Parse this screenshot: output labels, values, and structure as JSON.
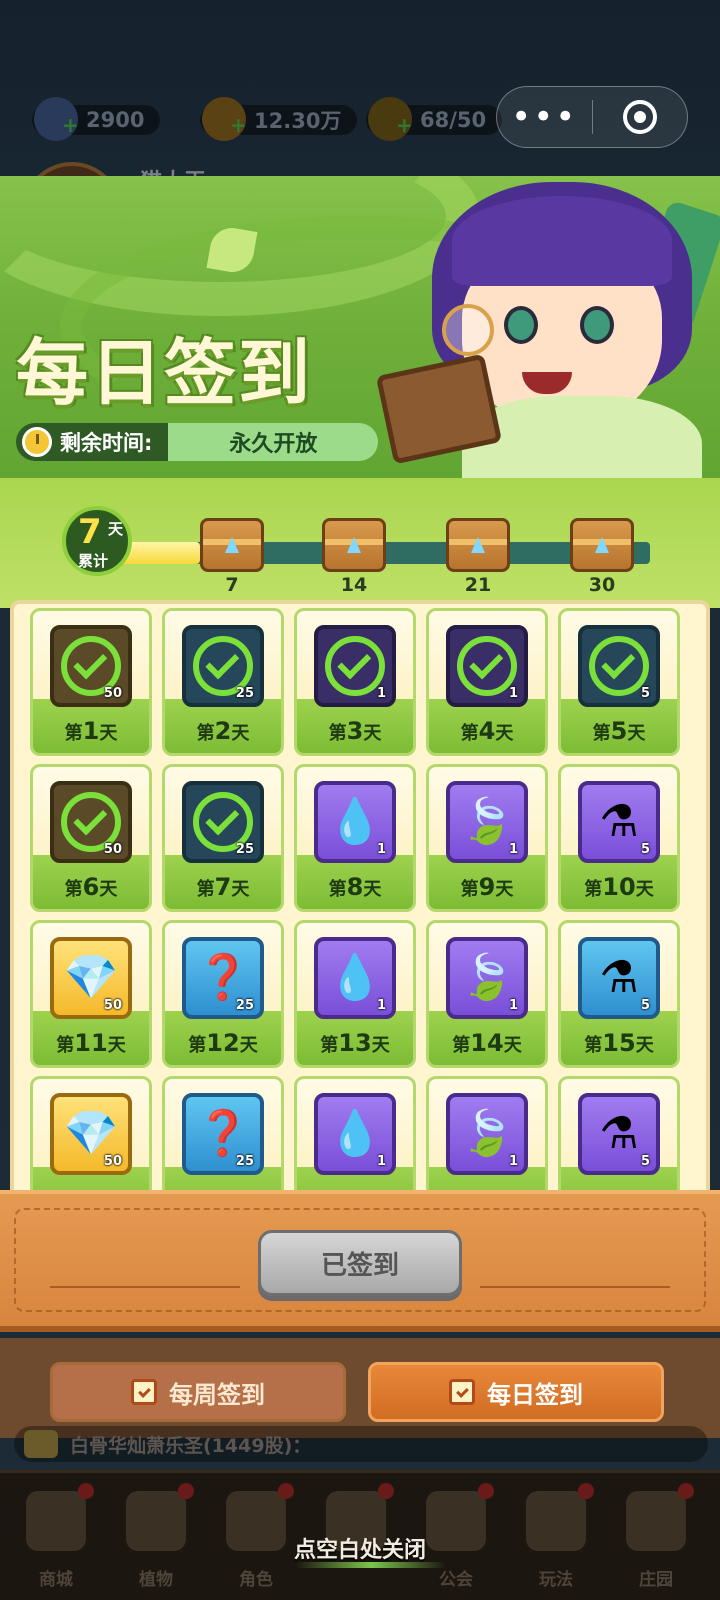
{
  "hud": {
    "diamonds": "2900",
    "coins": "12.30万",
    "energy": "68/50",
    "player_name": "猫大王"
  },
  "mini_program": {
    "more_icon": "more-dots-icon",
    "close_icon": "target-close-icon"
  },
  "modal": {
    "title": "每日签到",
    "time_label": "剩余时间:",
    "time_value": "永久开放"
  },
  "progress": {
    "days": "7",
    "days_unit": "天",
    "days_caption": "累计",
    "fill_fraction": 0.15,
    "milestones": [
      "7",
      "14",
      "21",
      "30"
    ]
  },
  "days": [
    {
      "prefix": "第",
      "num": "1",
      "suffix": "天",
      "state": "claimed",
      "icon_bg": "dim-brown",
      "qty": "50"
    },
    {
      "prefix": "第",
      "num": "2",
      "suffix": "天",
      "state": "claimed",
      "icon_bg": "dim-blue",
      "qty": "25"
    },
    {
      "prefix": "第",
      "num": "3",
      "suffix": "天",
      "state": "claimed",
      "icon_bg": "dim-purple",
      "qty": "1"
    },
    {
      "prefix": "第",
      "num": "4",
      "suffix": "天",
      "state": "claimed",
      "icon_bg": "dim-purple",
      "qty": "1"
    },
    {
      "prefix": "第",
      "num": "5",
      "suffix": "天",
      "state": "claimed",
      "icon_bg": "dim-blue",
      "qty": "5"
    },
    {
      "prefix": "第",
      "num": "6",
      "suffix": "天",
      "state": "claimed",
      "icon_bg": "dim-brown",
      "qty": "50"
    },
    {
      "prefix": "第",
      "num": "7",
      "suffix": "天",
      "state": "claimed",
      "icon_bg": "dim-blue",
      "qty": "25"
    },
    {
      "prefix": "第",
      "num": "8",
      "suffix": "天",
      "state": "locked",
      "icon_bg": "purple",
      "item": "drop-icon",
      "glyph": "💧",
      "qty": "1"
    },
    {
      "prefix": "第",
      "num": "9",
      "suffix": "天",
      "state": "locked",
      "icon_bg": "purple",
      "item": "leaf-icon",
      "glyph": "🍃",
      "qty": "1"
    },
    {
      "prefix": "第",
      "num": "10",
      "suffix": "天",
      "state": "locked",
      "icon_bg": "purple",
      "item": "potion-icon",
      "glyph": "⚗",
      "qty": "5"
    },
    {
      "prefix": "第",
      "num": "11",
      "suffix": "天",
      "state": "locked",
      "icon_bg": "gold",
      "item": "diamond-icon",
      "glyph": "💎",
      "qty": "50"
    },
    {
      "prefix": "第",
      "num": "12",
      "suffix": "天",
      "state": "locked",
      "icon_bg": "blue",
      "item": "mystery-seed-icon",
      "glyph": "❓",
      "qty": "25"
    },
    {
      "prefix": "第",
      "num": "13",
      "suffix": "天",
      "state": "locked",
      "icon_bg": "purple",
      "item": "drop-icon",
      "glyph": "💧",
      "qty": "1"
    },
    {
      "prefix": "第",
      "num": "14",
      "suffix": "天",
      "state": "locked",
      "icon_bg": "purple",
      "item": "leaf-icon",
      "glyph": "🍃",
      "qty": "1"
    },
    {
      "prefix": "第",
      "num": "15",
      "suffix": "天",
      "state": "locked",
      "icon_bg": "blue",
      "item": "potion-icon",
      "glyph": "⚗",
      "qty": "5"
    },
    {
      "prefix": "",
      "num": "",
      "suffix": "",
      "state": "locked",
      "icon_bg": "gold",
      "item": "diamond-icon",
      "glyph": "💎",
      "qty": "50"
    },
    {
      "prefix": "",
      "num": "",
      "suffix": "",
      "state": "locked",
      "icon_bg": "blue",
      "item": "mystery-seed-icon",
      "glyph": "❓",
      "qty": "25"
    },
    {
      "prefix": "",
      "num": "",
      "suffix": "",
      "state": "locked",
      "icon_bg": "purple",
      "item": "drop-icon",
      "glyph": "💧",
      "qty": "1"
    },
    {
      "prefix": "",
      "num": "",
      "suffix": "",
      "state": "locked",
      "icon_bg": "purple",
      "item": "leaf-icon",
      "glyph": "🍃",
      "qty": "1"
    },
    {
      "prefix": "",
      "num": "",
      "suffix": "",
      "state": "locked",
      "icon_bg": "purple",
      "item": "potion-icon",
      "glyph": "⚗",
      "qty": "5"
    }
  ],
  "actions": {
    "signed_label": "已签到",
    "weekly_tab": "每周签到",
    "daily_tab": "每日签到"
  },
  "ticker": {
    "text": "白骨华灿萧乐圣(1449股)："
  },
  "nav": {
    "items": [
      "商城",
      "植物",
      "角色",
      "",
      "公会",
      "玩法",
      "庄园"
    ],
    "close_hint": "点空白处关闭"
  }
}
